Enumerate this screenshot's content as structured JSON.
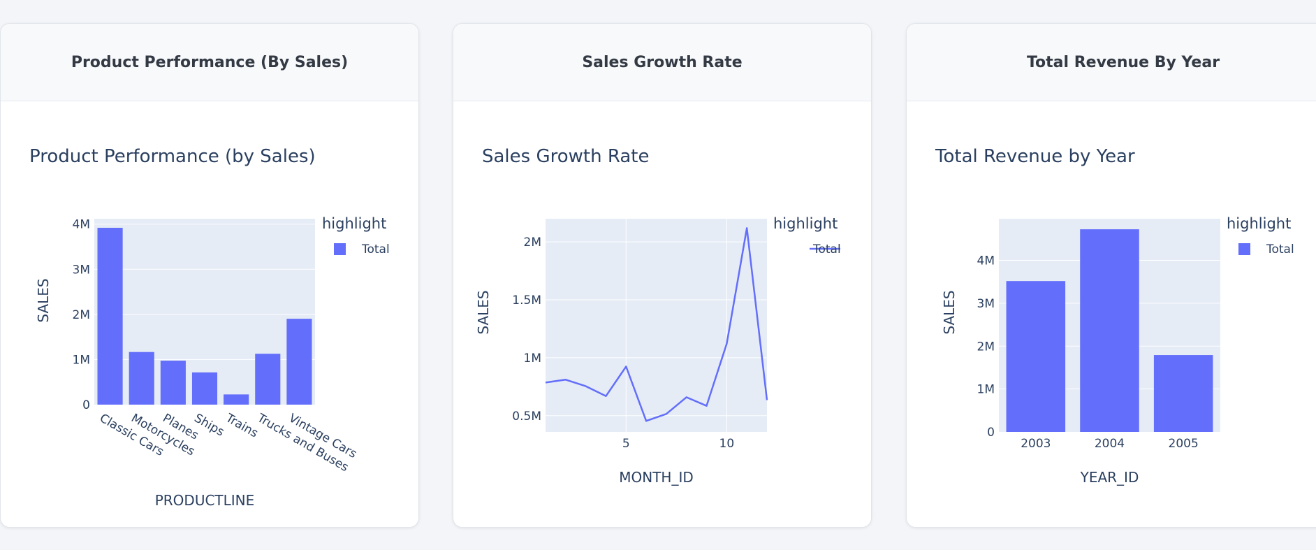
{
  "cards": [
    {
      "header": "Product Performance (By Sales)"
    },
    {
      "header": "Sales Growth Rate"
    },
    {
      "header": "Total Revenue By Year"
    }
  ],
  "colors": {
    "series": "#636efa",
    "plot_bg": "#e5ecf6",
    "text": "#2a3f5f"
  },
  "chart_data": [
    {
      "type": "bar",
      "title": "Product Performance (by Sales)",
      "xlabel": "PRODUCTLINE",
      "ylabel": "SALES",
      "categories": [
        "Classic Cars",
        "Motorcycles",
        "Planes",
        "Ships",
        "Trains",
        "Trucks and Buses",
        "Vintage Cars"
      ],
      "values": [
        3919615,
        1166388,
        975004,
        714437,
        226243,
        1127790,
        1903151
      ],
      "ylim": [
        0,
        4120000
      ],
      "yticks": [
        0,
        1000000,
        2000000,
        3000000,
        4000000
      ],
      "ytick_labels": [
        "0",
        "1M",
        "2M",
        "3M",
        "4M"
      ],
      "legend_title": "highlight",
      "series_name": "Total",
      "legend": "top-right"
    },
    {
      "type": "line",
      "title": "Sales Growth Rate",
      "xlabel": "MONTH_ID",
      "ylabel": "SALES",
      "x": [
        1,
        2,
        3,
        4,
        5,
        6,
        7,
        8,
        9,
        10,
        11,
        12
      ],
      "values": [
        785874,
        810442,
        754501,
        669391,
        923973,
        454757,
        514876,
        659310,
        584724,
        1121215,
        2118886,
        634679
      ],
      "xlim": [
        1,
        12
      ],
      "ylim": [
        360000,
        2200000
      ],
      "xticks": [
        5,
        10
      ],
      "xtick_labels": [
        "5",
        "10"
      ],
      "yticks": [
        500000,
        1000000,
        1500000,
        2000000
      ],
      "ytick_labels": [
        "0.5M",
        "1M",
        "1.5M",
        "2M"
      ],
      "legend_title": "highlight",
      "series_name": "Total",
      "legend": "top-right"
    },
    {
      "type": "bar",
      "title": "Total Revenue by Year",
      "xlabel": "YEAR_ID",
      "ylabel": "SALES",
      "categories": [
        "2003",
        "2004",
        "2005"
      ],
      "values": [
        3516980,
        4724163,
        1791487
      ],
      "ylim": [
        0,
        4970000
      ],
      "yticks": [
        0,
        1000000,
        2000000,
        3000000,
        4000000
      ],
      "ytick_labels": [
        "0",
        "1M",
        "2M",
        "3M",
        "4M"
      ],
      "legend_title": "highlight",
      "series_name": "Total",
      "legend": "top-right"
    }
  ]
}
